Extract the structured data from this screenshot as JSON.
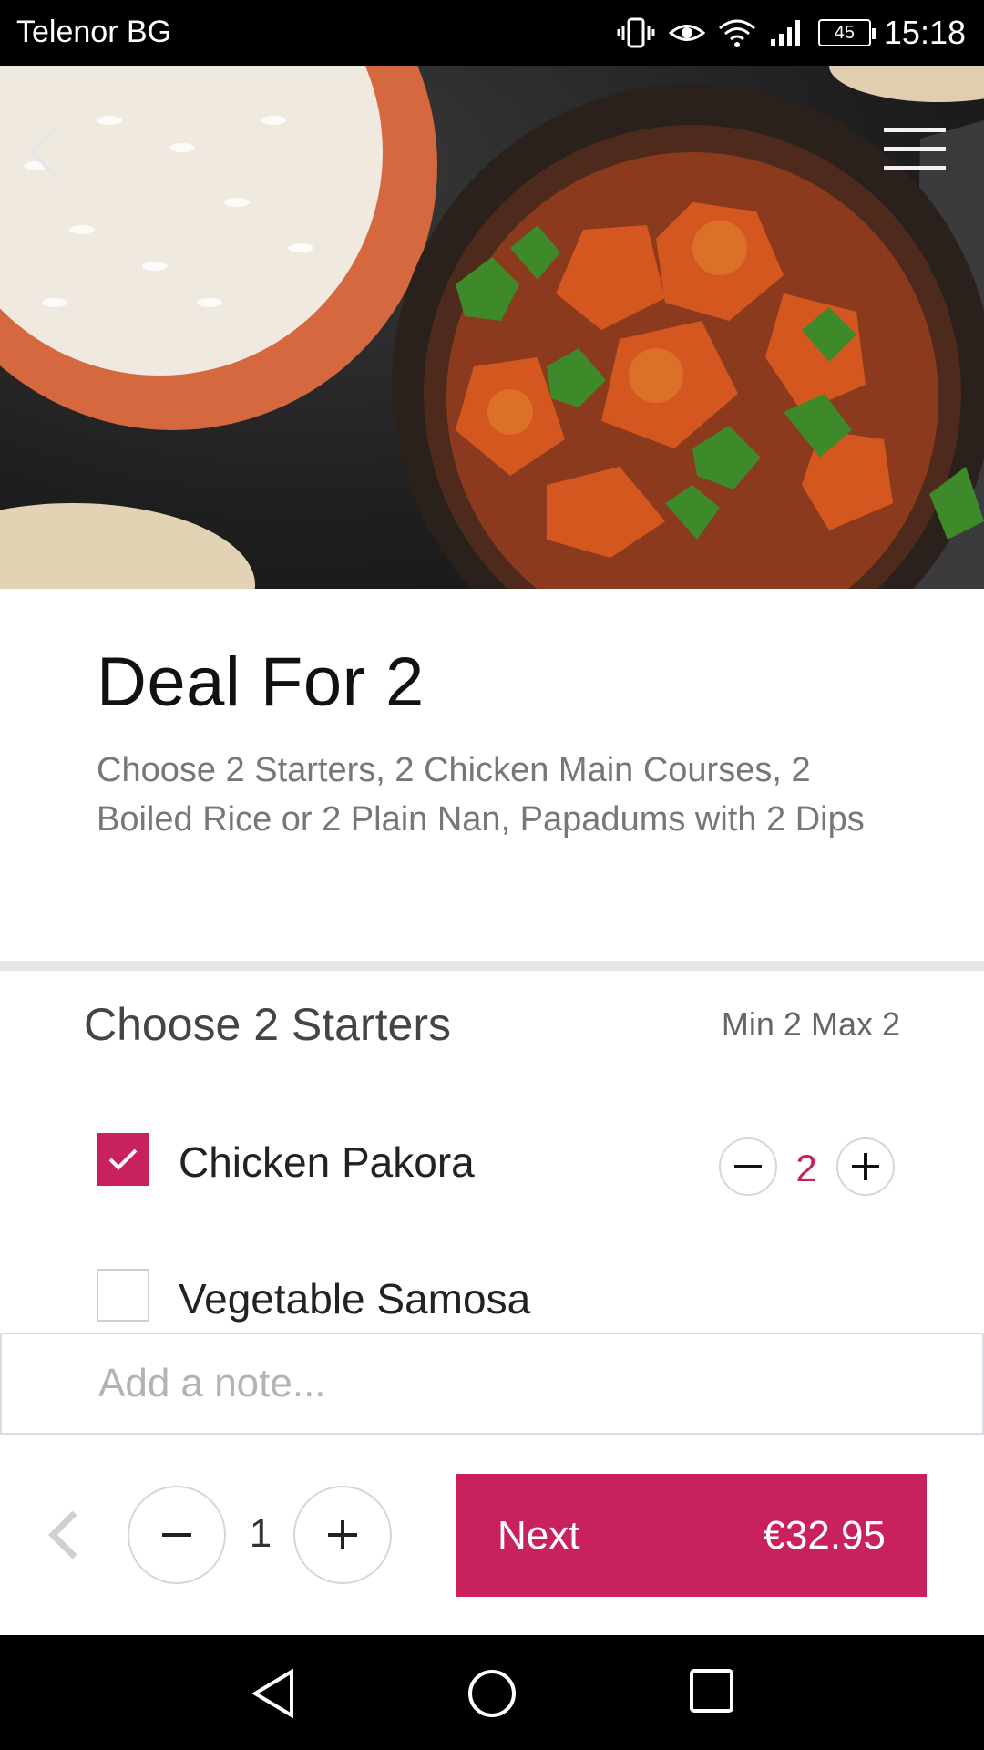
{
  "status_bar": {
    "carrier": "Telenor BG",
    "battery": "45",
    "time": "15:18"
  },
  "hero": {
    "image": "chicken-curry-with-rice-photo"
  },
  "deal": {
    "title": "Deal For 2",
    "description": "Choose 2 Starters, 2 Chicken Main Courses, 2 Boiled Rice or 2 Plain Nan, Papadums with 2 Dips"
  },
  "section": {
    "title": "Choose 2 Starters",
    "limits": "Min 2 Max 2",
    "options": [
      {
        "label": "Chicken Pakora",
        "checked": true,
        "quantity": "2"
      },
      {
        "label": "Vegetable Samosa",
        "checked": false
      }
    ]
  },
  "note": {
    "placeholder": "Add a note..."
  },
  "footer": {
    "quantity": "1",
    "next_label": "Next",
    "price": "€32.95"
  },
  "colors": {
    "accent": "#c8215e",
    "divider": "#e6e6e6"
  }
}
